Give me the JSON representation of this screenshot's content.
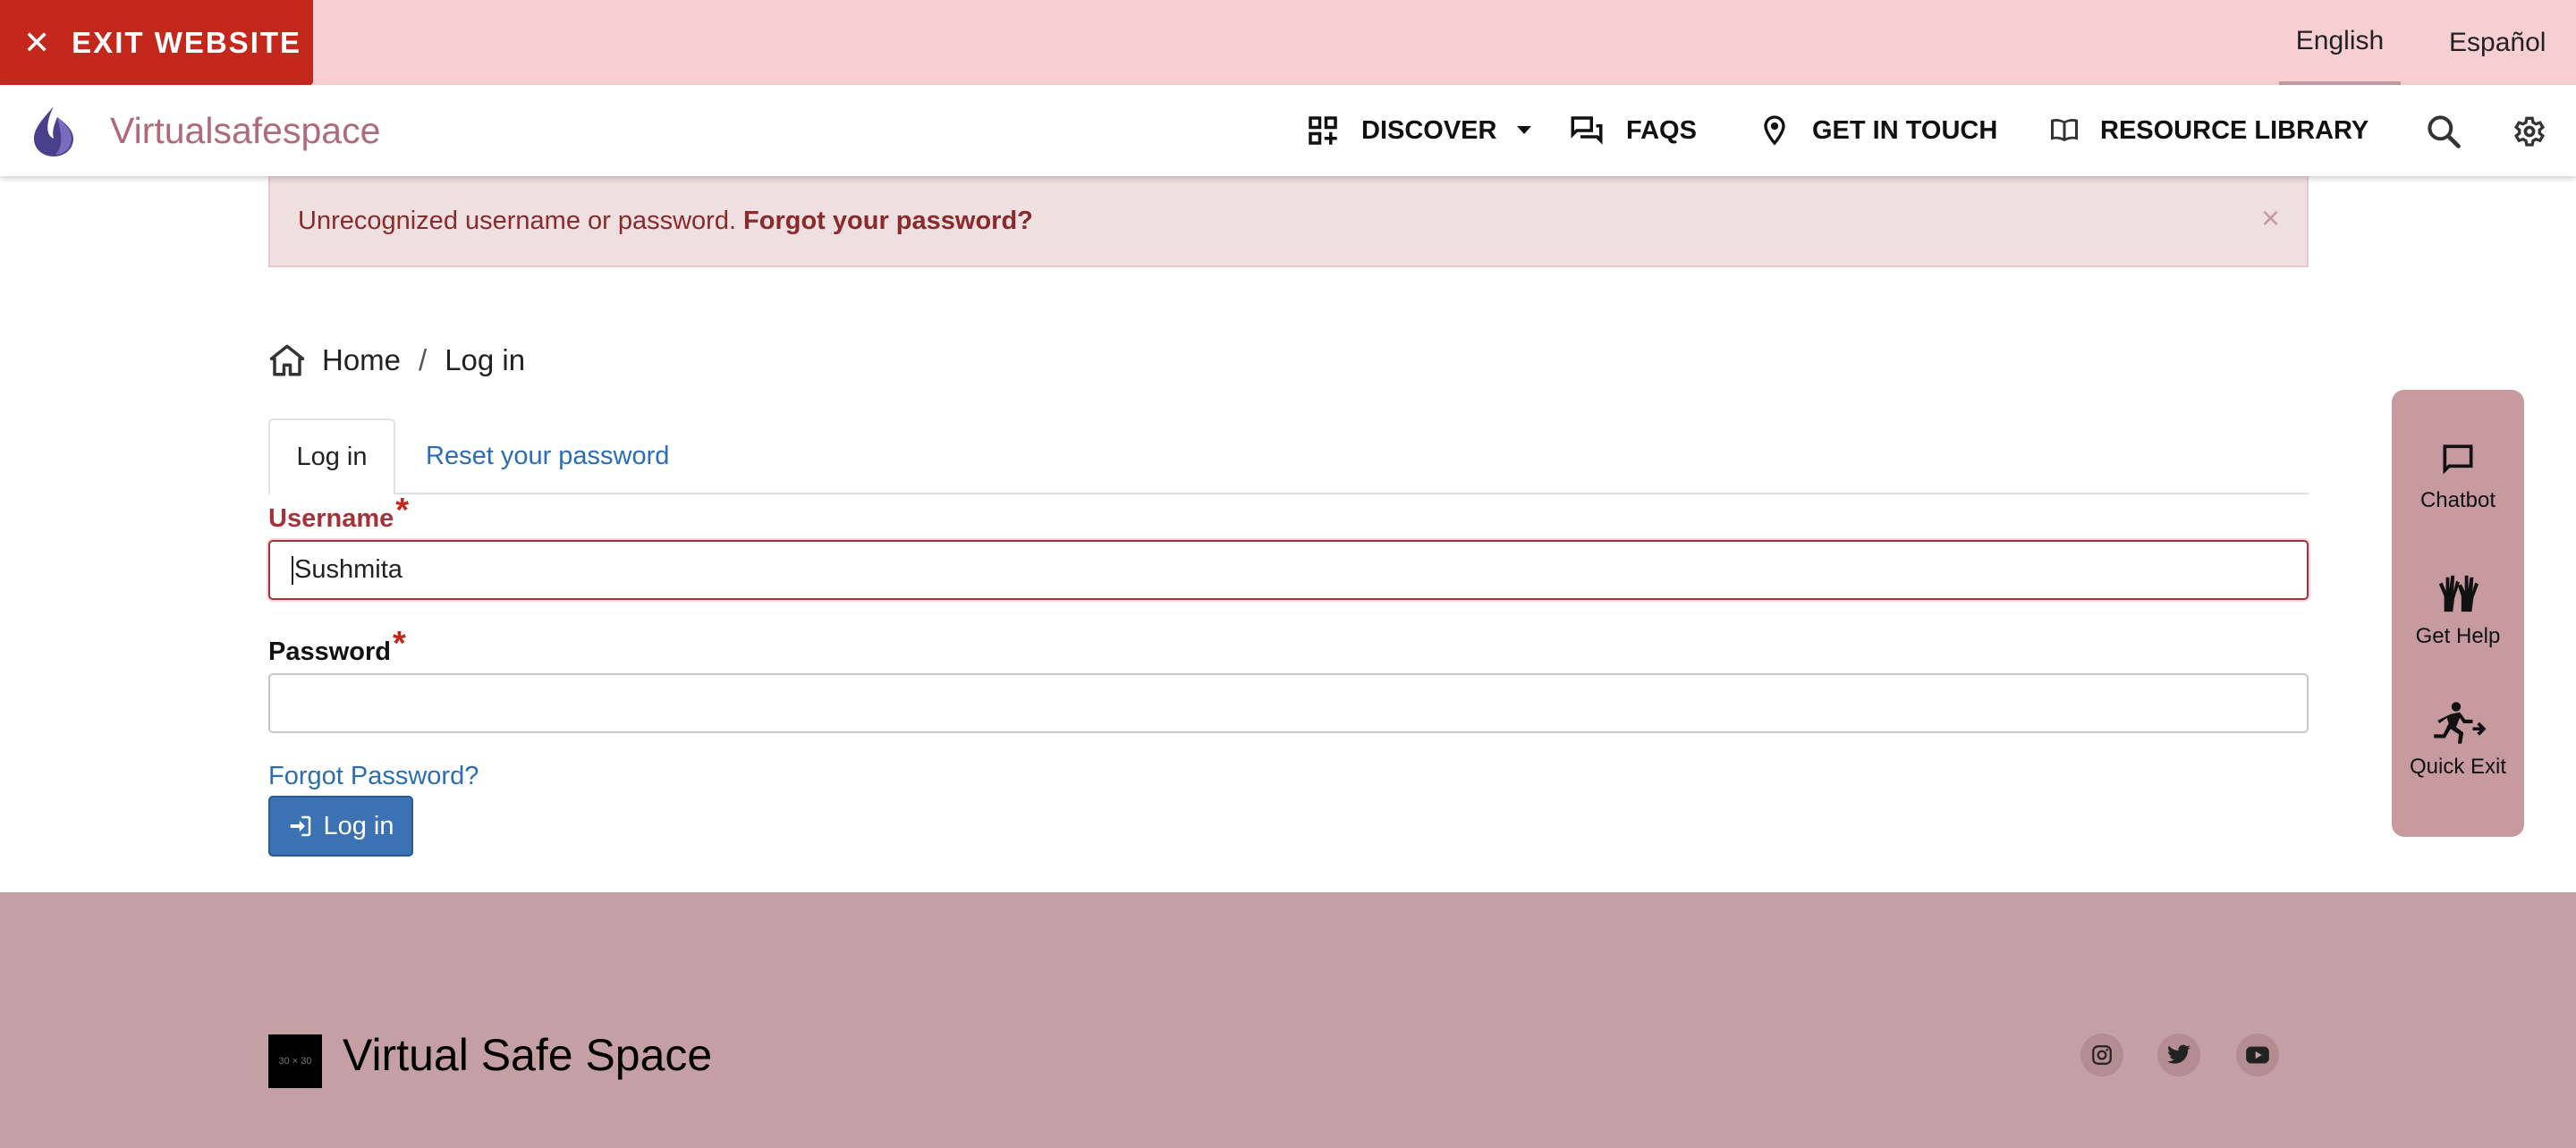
{
  "topbar": {
    "exit_label": "EXIT WEBSITE",
    "languages": [
      "English",
      "Español"
    ],
    "active_language": "English"
  },
  "nav": {
    "brand": "Virtualsafespace",
    "items": [
      {
        "label": "DISCOVER",
        "icon": "dashboard-icon",
        "has_dropdown": true
      },
      {
        "label": "FAQS",
        "icon": "forum-icon"
      },
      {
        "label": "GET IN TOUCH",
        "icon": "location-pin-icon"
      },
      {
        "label": "RESOURCE LIBRARY",
        "icon": "book-icon"
      }
    ],
    "utility_icons": [
      "search-icon",
      "gear-icon"
    ]
  },
  "alert": {
    "message": "Unrecognized username or password.",
    "link": "Forgot your password?",
    "close": "×"
  },
  "breadcrumb": {
    "home": "Home",
    "separator": "/",
    "current": "Log in"
  },
  "tabs": [
    {
      "label": "Log in",
      "active": true
    },
    {
      "label": "Reset your password",
      "active": false
    }
  ],
  "form": {
    "username_label": "Username",
    "username_value": "Sushmita",
    "password_label": "Password",
    "password_value": "",
    "required_mark": "*",
    "forgot_link": "Forgot Password?",
    "submit_label": "Log in"
  },
  "side_widget": {
    "items": [
      {
        "label": "Chatbot",
        "icon": "chat-icon"
      },
      {
        "label": "Get Help",
        "icon": "raised-hands-icon"
      },
      {
        "label": "Quick Exit",
        "icon": "running-person-icon"
      }
    ]
  },
  "footer": {
    "logo_text": "30 × 30",
    "title": "Virtual Safe Space",
    "social": [
      "instagram-icon",
      "twitter-icon",
      "youtube-icon"
    ]
  },
  "colors": {
    "exit_red": "#c4281c",
    "topbar_pink": "#f7cfd3",
    "brand_mauve": "#b06a7b",
    "link_blue": "#2a6db5",
    "button_blue": "#3a72b4",
    "footer_mauve": "#c4a0a4"
  }
}
